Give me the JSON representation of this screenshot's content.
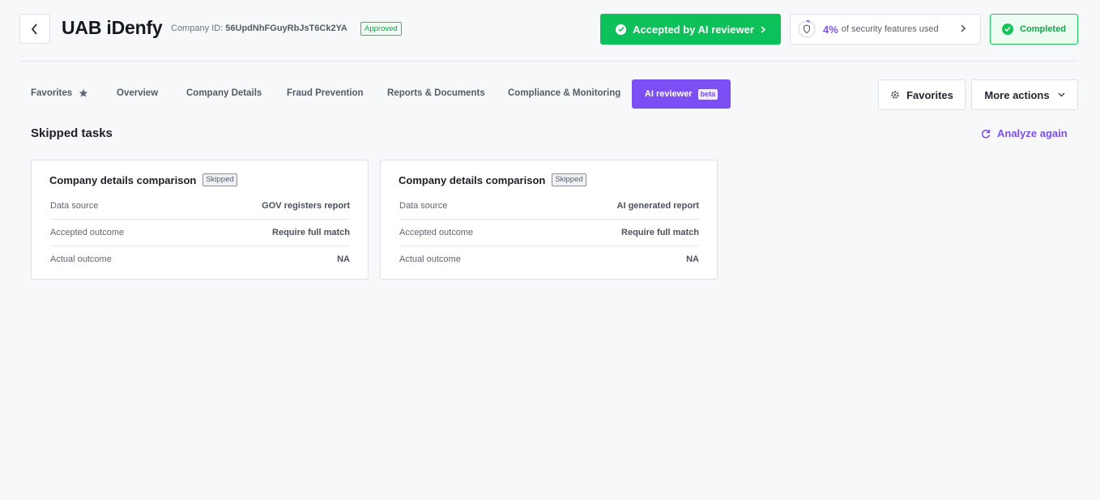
{
  "header": {
    "title": "UAB iDenfy",
    "company_id_label": "Company ID:",
    "company_id": "56UpdNhFGuyRbJsT6Ck2YA",
    "status_badge": "Approved",
    "ai_button": "Accepted by AI reviewer",
    "security_percent": "4%",
    "security_text": "of security features used",
    "security_fraction": 0.04,
    "completed": "Completed"
  },
  "tabs": [
    {
      "label": "Favorites"
    },
    {
      "label": "Overview"
    },
    {
      "label": "Company Details"
    },
    {
      "label": "Fraud Prevention"
    },
    {
      "label": "Reports & Documents"
    },
    {
      "label": "Compliance & Monitoring"
    },
    {
      "label": "AI reviewer",
      "badge": "beta",
      "active": true
    }
  ],
  "actions": {
    "favorites": "Favorites",
    "more_actions": "More actions"
  },
  "section": {
    "title": "Skipped tasks",
    "analyze_again": "Analyze again"
  },
  "cards": [
    {
      "title": "Company details comparison",
      "status": "Skipped",
      "rows": [
        {
          "label": "Data source",
          "value": "GOV registers report"
        },
        {
          "label": "Accepted outcome",
          "value": "Require full match"
        },
        {
          "label": "Actual outcome",
          "value": "NA"
        }
      ]
    },
    {
      "title": "Company details comparison",
      "status": "Skipped",
      "rows": [
        {
          "label": "Data source",
          "value": "AI generated report"
        },
        {
          "label": "Accepted outcome",
          "value": "Require full match"
        },
        {
          "label": "Actual outcome",
          "value": "NA"
        }
      ]
    }
  ],
  "colors": {
    "accent": "#7b4ff4",
    "success": "#0cc15a",
    "background": "#f7f8fa"
  },
  "icons": [
    "chevron-left-icon",
    "check-circle-icon",
    "chevron-right-icon",
    "shield-icon",
    "star-icon",
    "gear-icon",
    "chevron-down-icon",
    "refresh-icon"
  ]
}
